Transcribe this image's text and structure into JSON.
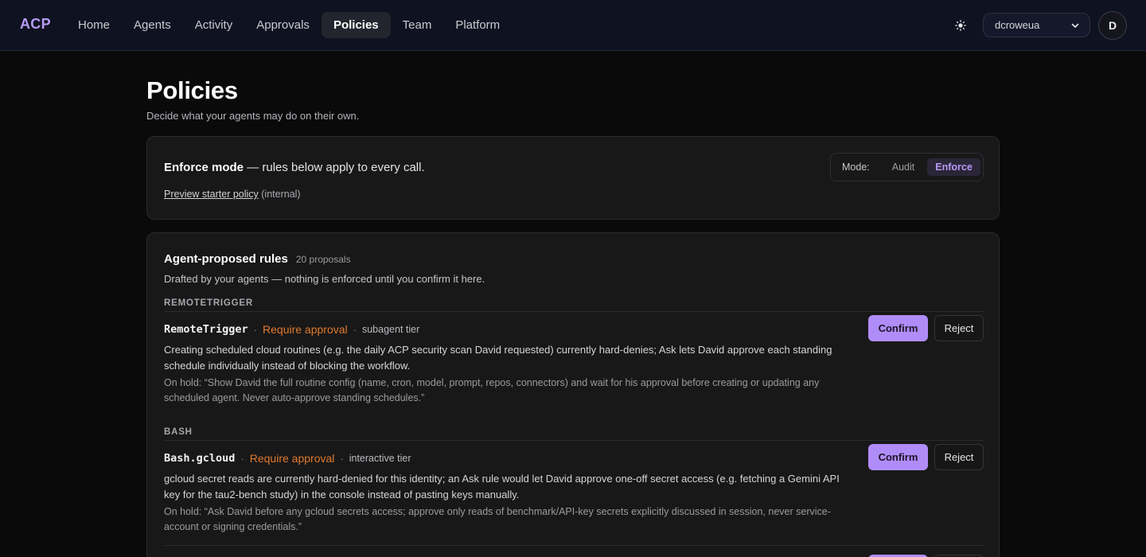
{
  "app": {
    "logo": "ACP"
  },
  "nav": {
    "items": [
      {
        "label": "Home"
      },
      {
        "label": "Agents"
      },
      {
        "label": "Activity"
      },
      {
        "label": "Approvals"
      },
      {
        "label": "Policies"
      },
      {
        "label": "Team"
      },
      {
        "label": "Platform"
      }
    ],
    "active": "Policies"
  },
  "header": {
    "theme_icon": "sun-icon",
    "org_select": {
      "value": "dcroweua"
    },
    "avatar_initial": "D"
  },
  "page": {
    "title": "Policies",
    "subtitle": "Decide what your agents may do on their own."
  },
  "mode_card": {
    "mode_name": "Enforce mode",
    "mode_desc": " — rules below apply to every call.",
    "preview_link": "Preview starter policy",
    "preview_suffix": " (internal)",
    "switch_label": "Mode:",
    "options": [
      "Audit",
      "Enforce"
    ],
    "selected": "Enforce"
  },
  "rules": {
    "title": "Agent-proposed rules",
    "count": "20 proposals",
    "description": "Drafted by your agents — nothing is enforced until you confirm it here.",
    "confirm_label": "Confirm",
    "reject_label": "Reject",
    "groups": [
      {
        "label": "REMOTETRIGGER",
        "rule": {
          "name": "RemoteTrigger",
          "action": "Require approval",
          "tier": "subagent tier",
          "body": "Creating scheduled cloud routines (e.g. the daily ACP security scan David requested) currently hard-denies; Ask lets David approve each standing schedule individually instead of blocking the workflow.",
          "hold": "On hold: “Show David the full routine config (name, cron, model, prompt, repos, connectors) and wait for his approval before creating or updating any scheduled agent. Never auto-approve standing schedules.”"
        }
      },
      {
        "label": "BASH",
        "rule": {
          "name": "Bash.gcloud",
          "action": "Require approval",
          "tier": "interactive tier",
          "body": "gcloud secret reads are currently hard-denied for this identity; an Ask rule would let David approve one-off secret access (e.g. fetching a Gemini API key for the tau2-bench study) in the console instead of pasting keys manually.",
          "hold": "On hold: “Ask David before any gcloud secrets access; approve only reads of benchmark/API-key secrets explicitly discussed in session, never service-account or signing credentials.”"
        }
      }
    ]
  },
  "colors": {
    "accent": "#b08cf8",
    "logo": "#b79cf5",
    "action": "#e07a2e",
    "background": "#0a0a0a",
    "topbar": "#0f1221"
  }
}
